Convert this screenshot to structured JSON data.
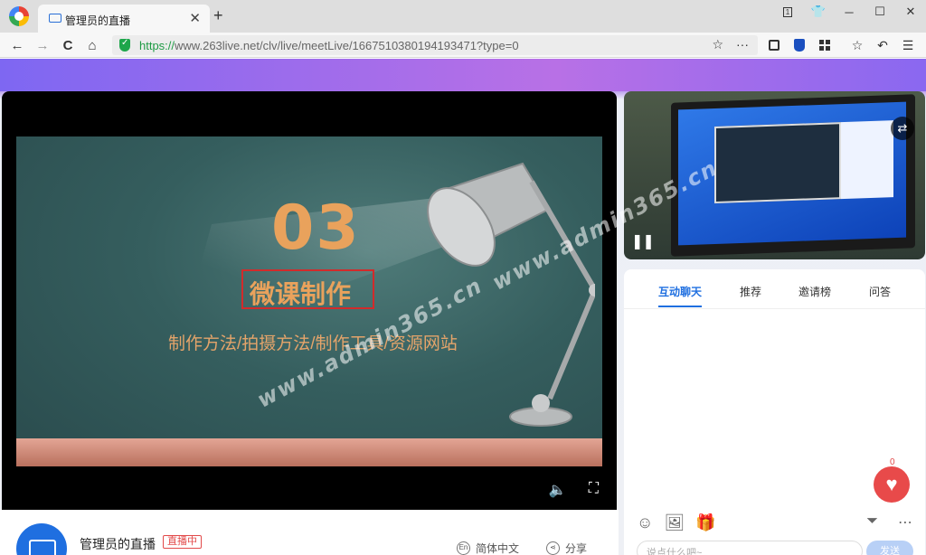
{
  "browser": {
    "tab_title": "管理员的直播",
    "tab_close": "✕",
    "new_tab": "+",
    "url_protocol": "https://",
    "url_rest": "www.263live.net/clv/live/meetLive/1667510380194193471?type=0",
    "window_buttons": [
      "1",
      "👕",
      "─",
      "☐",
      "✕"
    ],
    "nav": {
      "back": "←",
      "forward": "→",
      "reload": "C",
      "home": "⌂"
    },
    "url_actions": {
      "star": "☆",
      "more": "···"
    }
  },
  "slide": {
    "number": "03",
    "title": "微课制作",
    "subtitle": "制作方法/拍摄方法/制作工具/资源网站"
  },
  "player_controls": {
    "volume": "🔈",
    "fullscreen": "⛶"
  },
  "host": {
    "name": "管理员的直播",
    "badge": "直播中",
    "language": "简体中文",
    "share": "分享"
  },
  "side_video": {
    "swap": "⇄",
    "pause": "❚❚"
  },
  "chat": {
    "tabs": [
      "互动聊天",
      "推荐",
      "邀请榜",
      "问答"
    ],
    "like_count": "0",
    "input_placeholder": "说点什么吧~",
    "send": "发送"
  },
  "watermarks": [
    "www.admin365.cn",
    "www.admin365.cn",
    "www.admin365.cn"
  ],
  "colors": {
    "accent": "#1f6fe0",
    "live_red": "#e24a4a",
    "slide_text": "#e9a25c"
  }
}
